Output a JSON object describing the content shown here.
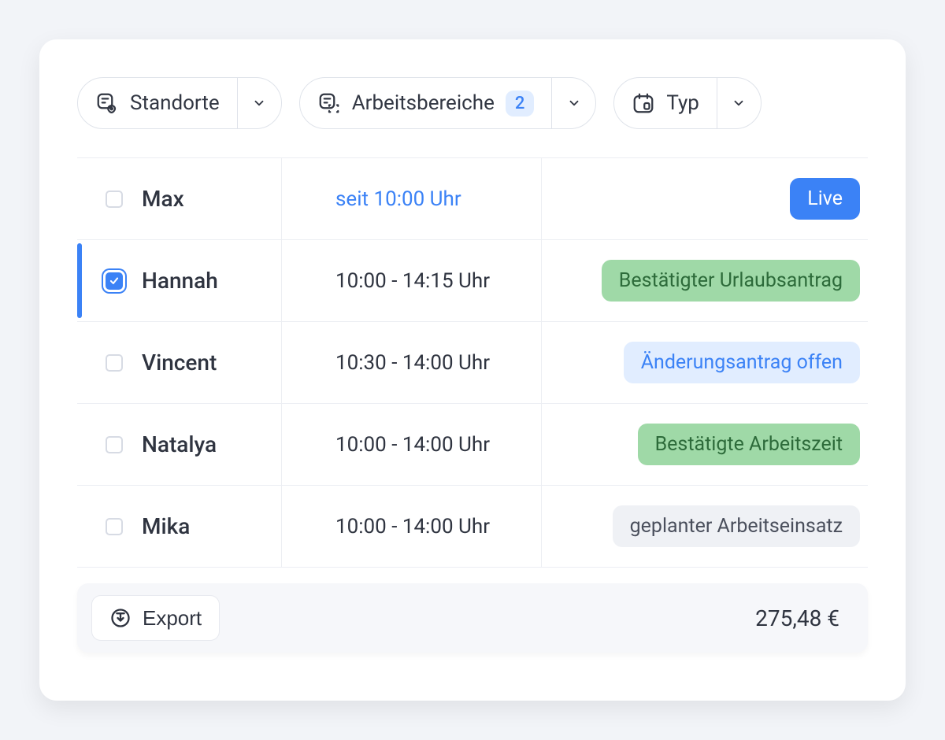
{
  "filters": {
    "locations": {
      "label": "Standorte"
    },
    "areas": {
      "label": "Arbeitsbereiche",
      "badge": "2"
    },
    "type": {
      "label": "Typ"
    }
  },
  "rows": [
    {
      "name": "Max",
      "time": "seit 10:00 Uhr",
      "status": "Live",
      "checked": false,
      "live": true,
      "style": "live"
    },
    {
      "name": "Hannah",
      "time": "10:00 - 14:15 Uhr",
      "status": "Bestätigter Urlaubsantrag",
      "checked": true,
      "live": false,
      "style": "green"
    },
    {
      "name": "Vincent",
      "time": "10:30 - 14:00 Uhr",
      "status": "Änderungsantrag offen",
      "checked": false,
      "live": false,
      "style": "blue"
    },
    {
      "name": "Natalya",
      "time": "10:00 - 14:00 Uhr",
      "status": "Bestätigte Arbeitszeit",
      "checked": false,
      "live": false,
      "style": "green"
    },
    {
      "name": "Mika",
      "time": "10:00 - 14:00 Uhr",
      "status": "geplanter Arbeitseinsatz",
      "checked": false,
      "live": false,
      "style": "gray"
    }
  ],
  "footer": {
    "export_label": "Export",
    "total": "275,48 €"
  }
}
